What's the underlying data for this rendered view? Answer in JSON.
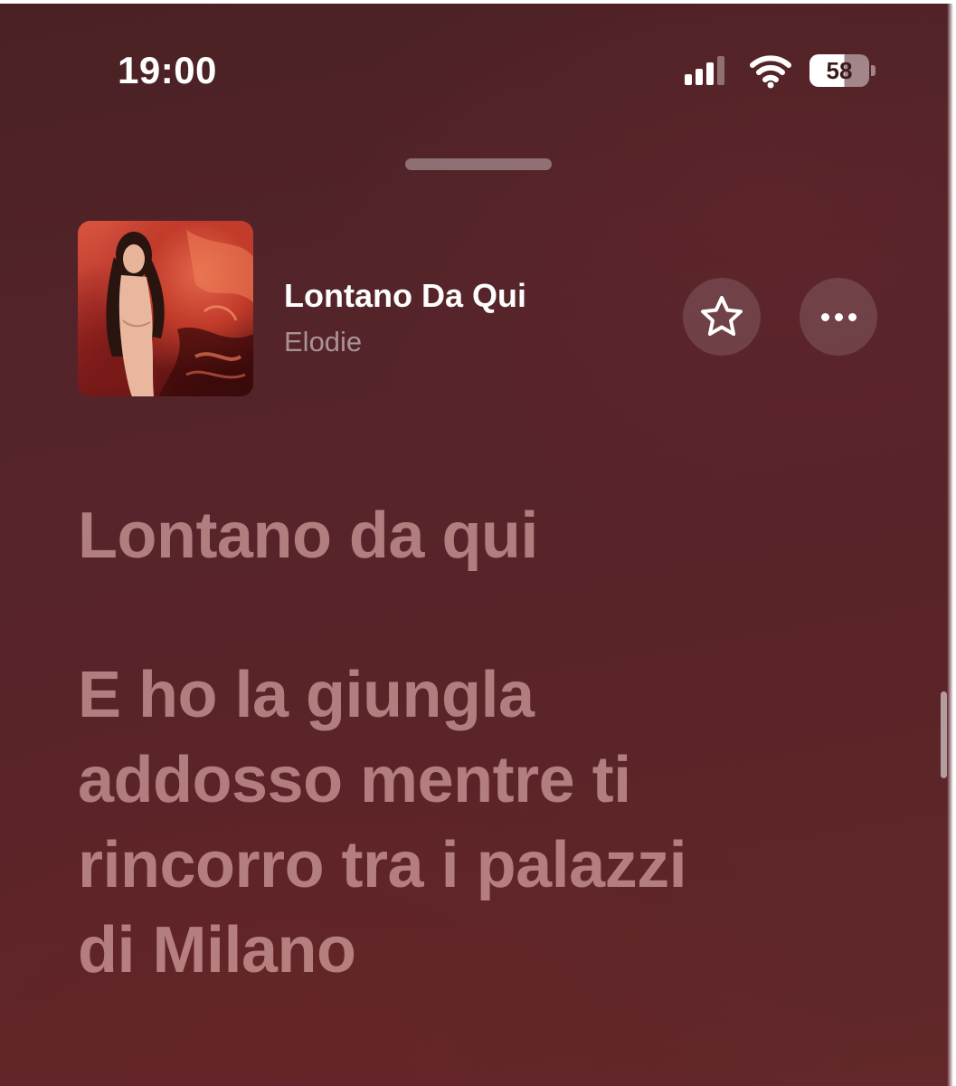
{
  "status_bar": {
    "time": "19:00",
    "battery_level": "58",
    "signal_icon": "cellular-signal-icon",
    "wifi_icon": "wifi-icon",
    "battery_icon": "battery-icon"
  },
  "now_playing": {
    "title": "Lontano Da Qui",
    "artist": "Elodie",
    "artwork_icon": "album-artwork",
    "favorite_icon": "star-icon",
    "more_icon": "ellipsis-icon"
  },
  "lyrics": {
    "lines": [
      "Lontano da qui",
      "E ho la giungla",
      "addosso mentre ti",
      "rincorro tra i palazzi",
      "di Milano"
    ]
  },
  "colors": {
    "background": "#55242a",
    "lyric_text": "#e8b4b4",
    "artist_text": "#b89396"
  }
}
